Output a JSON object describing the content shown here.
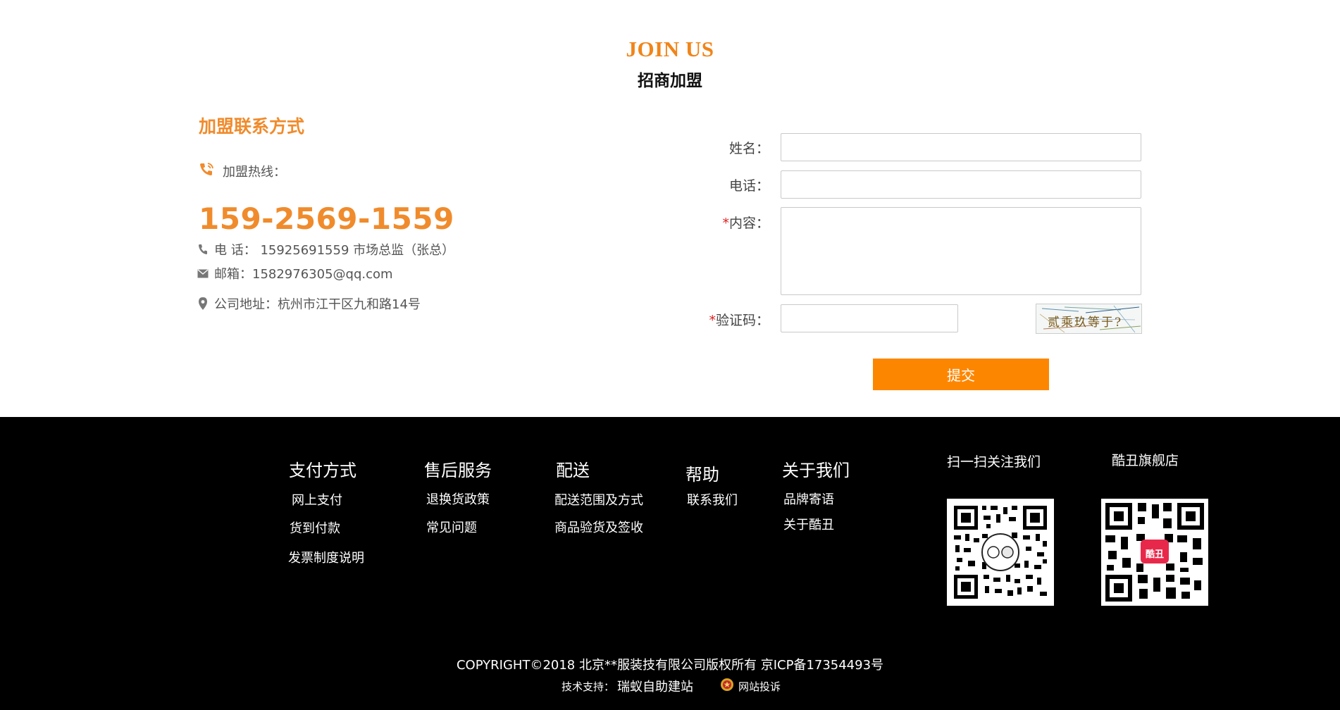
{
  "header": {
    "title_en": "JOIN US",
    "title_cn": "招商加盟"
  },
  "contact": {
    "section_title": "加盟联系方式",
    "hotline_label": "加盟热线：",
    "hotline_number": "159-2569-1559",
    "phone_line": "电 话： 15925691559 市场总监（张总）",
    "email_line": "邮箱：1582976305@qq.com",
    "address_line": "公司地址：杭州市江干区九和路14号"
  },
  "form": {
    "name_label": "姓名：",
    "phone_label": "电话：",
    "content_label": "内容：",
    "captcha_label": "验证码：",
    "required_mark": "*",
    "captcha_text": "贰乘玖等于?",
    "submit_label": "提交"
  },
  "footer": {
    "columns": [
      {
        "title": "支付方式",
        "links": [
          "网上支付",
          "货到付款",
          "发票制度说明"
        ]
      },
      {
        "title": "售后服务",
        "links": [
          "退换货政策",
          "常见问题"
        ]
      },
      {
        "title": "配送",
        "links": [
          "配送范围及方式",
          "商品验货及签收"
        ]
      },
      {
        "title": "帮助",
        "links": [
          "联系我们"
        ]
      },
      {
        "title": "关于我们",
        "links": [
          "品牌寄语",
          "关于酷丑"
        ]
      }
    ],
    "qr_follow_title": "扫一扫关注我们",
    "qr_store_title": "酷丑旗舰店",
    "qr_badge_text": "酷丑",
    "copyright": "COPYRIGHT©2018 北京**服装技有限公司版权所有 京ICP备17354493号",
    "support_label": "技术支持：",
    "support_brand": "瑞蚁自助建站",
    "complain_label": "网站投诉"
  },
  "colors": {
    "accent_orange": "#f08b2c",
    "button_orange": "#fd8600",
    "footer_bg": "#000000"
  }
}
